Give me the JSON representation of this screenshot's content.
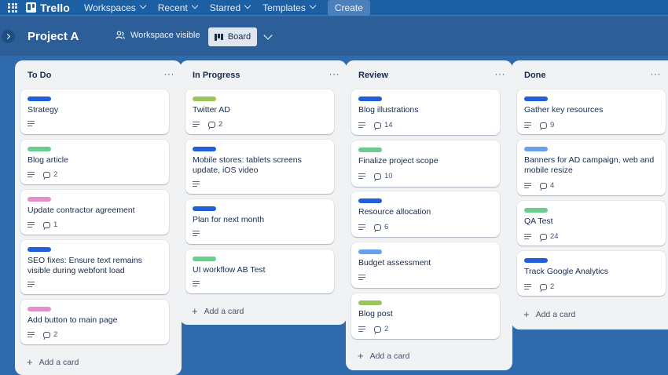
{
  "nav": {
    "brand": "Trello",
    "items": [
      "Workspaces",
      "Recent",
      "Starred",
      "Templates"
    ],
    "create_label": "Create"
  },
  "board": {
    "title": "Project A",
    "visibility": "Workspace visible",
    "view": "Board"
  },
  "colors": {
    "blue": "#1f5fd8",
    "lime": "#9bc55a",
    "green": "#6acc8f",
    "pink": "#e48fca",
    "lightblue": "#66a0ef"
  },
  "lists": [
    {
      "title": "To Do",
      "add_label": "Add a card",
      "cards": [
        {
          "label_color": "blue",
          "title": "Strategy",
          "comments": ""
        },
        {
          "label_color": "green",
          "title": "Blog article",
          "comments": "2"
        },
        {
          "label_color": "pink",
          "title": "Update contractor agreement",
          "comments": "1"
        },
        {
          "label_color": "blue",
          "title": "SEO fixes: Ensure text remains visible during webfont load",
          "comments": ""
        },
        {
          "label_color": "pink",
          "title": "Add button to main page",
          "comments": "2"
        }
      ]
    },
    {
      "title": "In Progress",
      "add_label": "Add a card",
      "cards": [
        {
          "label_color": "lime",
          "title": "Twitter AD",
          "comments": "2"
        },
        {
          "label_color": "blue",
          "title": "Mobile stores: tablets screens update, iOS video",
          "comments": ""
        },
        {
          "label_color": "blue",
          "title": "Plan for next month",
          "comments": ""
        },
        {
          "label_color": "green",
          "title": "UI workflow AB Test",
          "comments": ""
        }
      ]
    },
    {
      "title": "Review",
      "add_label": "Add a card",
      "cards": [
        {
          "label_color": "blue",
          "title": "Blog illustrations",
          "comments": "14"
        },
        {
          "label_color": "green",
          "title": "Finalize project scope",
          "comments": "10"
        },
        {
          "label_color": "blue",
          "title": "Resource allocation",
          "comments": "6"
        },
        {
          "label_color": "lightblue",
          "title": "Budget assessment",
          "comments": ""
        },
        {
          "label_color": "lime",
          "title": "Blog post",
          "comments": "2"
        }
      ]
    },
    {
      "title": "Done",
      "add_label": "Add a card",
      "cards": [
        {
          "label_color": "blue",
          "title": "Gather key resources",
          "comments": "9"
        },
        {
          "label_color": "lightblue",
          "title": "Banners for AD campaign, web and mobile resize",
          "comments": "4"
        },
        {
          "label_color": "green",
          "title": "QA Test",
          "comments": "24"
        },
        {
          "label_color": "blue",
          "title": "Track Google Analytics",
          "comments": "2"
        }
      ]
    }
  ]
}
